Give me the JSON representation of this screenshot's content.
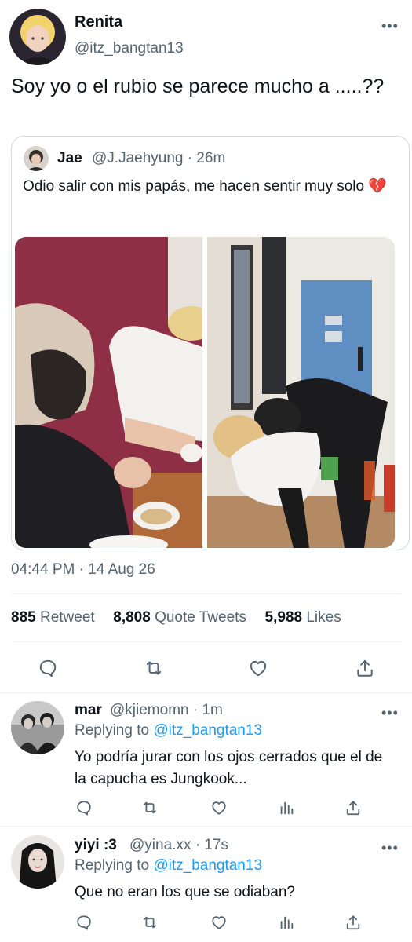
{
  "tweet": {
    "author_name": "Renita",
    "author_handle": "@itz_bangtan13",
    "text": "Soy yo o el rubio se parece mucho a .....??",
    "timestamp": "04:44 PM · 14 Aug 26",
    "stats": {
      "retweets_count": "885",
      "retweets_label": "Retweet",
      "quotes_count": "8,808",
      "quotes_label": "Quote Tweets",
      "likes_count": "5,988",
      "likes_label": "Likes"
    }
  },
  "quote": {
    "author_name": "Jae",
    "author_handle_time": "@J.Jaehyung · 26m",
    "text": "Odio salir con mis papás, me hacen sentir muy solo 💔"
  },
  "replies": [
    {
      "name": "mar",
      "handle_time": "@kjiemomn · 1m",
      "replying_prefix": "Replying to",
      "replying_mention": "@itz_bangtan13",
      "text": "Yo podría jurar con los ojos cerrados que el de la capucha es Jungkook..."
    },
    {
      "name": "yiyi :3",
      "handle_time": "@yina.xx · 17s",
      "replying_prefix": "Replying to",
      "replying_mention": "@itz_bangtan13",
      "text": "Que no eran los que se odiaban?"
    }
  ],
  "icons": {
    "reply": "speech-bubble-icon",
    "retweet": "retweet-arrows-icon",
    "like": "heart-outline-icon",
    "analytics": "bar-chart-icon",
    "share": "share-upload-icon",
    "more": "more-dots-icon"
  },
  "colors": {
    "text_primary": "#0f1419",
    "text_secondary": "#536471",
    "accent_blue": "#1d9bf0",
    "divider": "#eff3f4"
  }
}
